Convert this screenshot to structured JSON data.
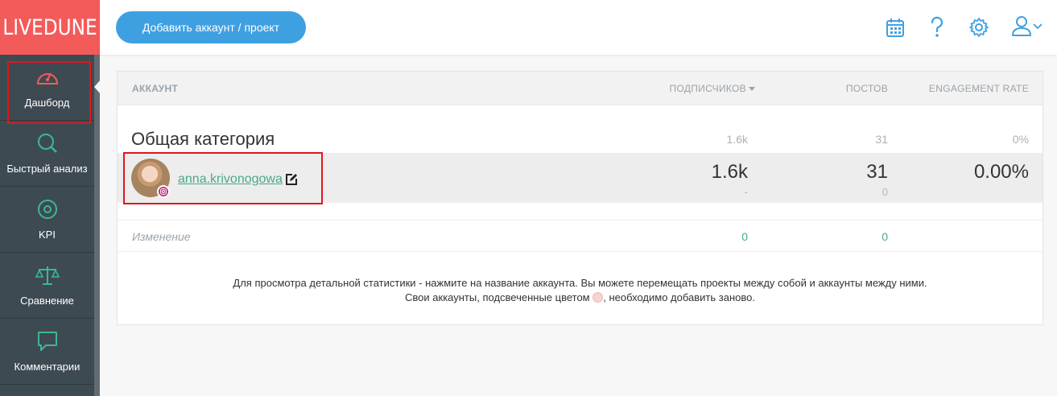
{
  "logo": "LIVEDUNE",
  "sidebar": {
    "items": [
      {
        "label": "Дашборд",
        "icon": "speedometer-icon"
      },
      {
        "label": "Быстрый анализ",
        "icon": "search-icon"
      },
      {
        "label": "KPI",
        "icon": "target-icon"
      },
      {
        "label": "Сравнение",
        "icon": "scales-icon"
      },
      {
        "label": "Комментарии",
        "icon": "chat-bubble-icon"
      }
    ]
  },
  "header": {
    "add_button": "Добавить аккаунт / проект",
    "icons": [
      "calendar-icon",
      "help-icon",
      "gear-icon",
      "user-icon",
      "chevron-down-icon"
    ]
  },
  "table": {
    "columns": {
      "account": "АККАУНТ",
      "subscribers": "ПОДПИСЧИКОВ",
      "posts": "ПОСТОВ",
      "engagement": "ENGAGEMENT RATE"
    },
    "category": {
      "title": "Общая категория",
      "subscribers": "1.6k",
      "posts": "31",
      "engagement": "0%"
    },
    "account_row": {
      "name": "anna.krivonogowa",
      "subscribers": "1.6k",
      "subscribers_change": "-",
      "posts": "31",
      "posts_change": "0",
      "engagement": "0.00%"
    },
    "change_row": {
      "label": "Изменение",
      "subscribers": "0",
      "posts": "0"
    }
  },
  "note": {
    "line1": "Для просмотра детальной статистики - нажмите на название аккаунта. Вы можете перемещать проекты между собой и аккаунты между ними.",
    "line2_before": "Свои аккаунты, подсвеченные цветом",
    "line2_after": ", необходимо добавить заново."
  },
  "colors": {
    "brand": "#f35b5b",
    "sidebar": "#3e4a51",
    "accent_blue": "#3fa0e1",
    "accent_green": "#4aa88e",
    "highlight_red": "#e0161d"
  }
}
